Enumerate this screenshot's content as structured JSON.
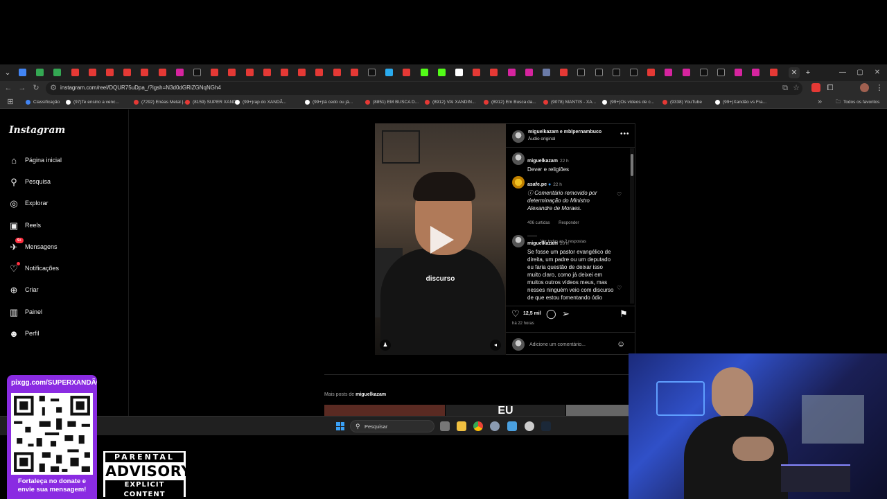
{
  "browser": {
    "url": "instagram.com/reel/DQUR75uDpa_/?igsh=N3d0dGRiZGNqNGh4",
    "bookmarks": [
      {
        "label": "Classificação",
        "color": "#4285f4"
      },
      {
        "label": "(97)Te ensino a venc...",
        "color": "#ffffff"
      },
      {
        "label": "(7292) Enéas Metal |...",
        "color": "#e53935"
      },
      {
        "label": "(8159) SUPER XAND...",
        "color": "#e53935"
      },
      {
        "label": "(99+)rap do XANDÃ...",
        "color": "#ffffff"
      },
      {
        "label": "(99+)tá cedo ou já...",
        "color": "#ffffff"
      },
      {
        "label": "(8851) EM BUSCA D...",
        "color": "#e53935"
      },
      {
        "label": "(8912) VAI XANDIN...",
        "color": "#e53935"
      },
      {
        "label": "(8912) Em Busca da...",
        "color": "#e53935"
      },
      {
        "label": "(9078) MANTIS - XA...",
        "color": "#e53935"
      },
      {
        "label": "(99+)Os vídeos de c...",
        "color": "#ffffff"
      },
      {
        "label": "(9338) YouTube",
        "color": "#e53935"
      },
      {
        "label": "(99+)Xandão vs Fra...",
        "color": "#ffffff"
      }
    ],
    "all_bookmarks": "Todos os favoritos"
  },
  "instagram": {
    "logo": "Instagram",
    "nav": [
      {
        "label": "Página inicial",
        "icon": "home-icon"
      },
      {
        "label": "Pesquisa",
        "icon": "search-icon"
      },
      {
        "label": "Explorar",
        "icon": "compass-icon"
      },
      {
        "label": "Reels",
        "icon": "reels-icon"
      },
      {
        "label": "Mensagens",
        "icon": "messenger-icon"
      },
      {
        "label": "Notificações",
        "icon": "heart-icon"
      },
      {
        "label": "Criar",
        "icon": "plus-icon"
      },
      {
        "label": "Painel",
        "icon": "dashboard-icon"
      },
      {
        "label": "Perfil",
        "icon": "profile-avatar"
      }
    ],
    "messages_badge": "9+",
    "reel_caption": "discurso",
    "post": {
      "header_users": "miguelkazam e mblpernambuco",
      "audio": "Áudio original",
      "comments": [
        {
          "user": "miguelkazam",
          "time": "22 h",
          "text": "Dever e religiões"
        },
        {
          "user": "asafe.pe",
          "time": "22 h",
          "text": "ⓘ Comentário removido por determinação do Ministro Alexandre de Moraes.",
          "likes": "406 curtidas",
          "reply": "Responder",
          "view_replies": "Ver todas as 2 respostas"
        },
        {
          "user": "miguelkazam",
          "time": "20 h",
          "text": "Se fosse um pastor evangélico de direita, um padre ou um deputado eu faria questão de deixar isso muito claro, como já deixei em muitos outros vídeos meus, mas nesses ninguém veio com discurso de que estou fomentando ódio"
        }
      ],
      "likes_count": "12,5 mil",
      "posted_ago": "há 22 horas",
      "comment_placeholder": "Adicione um comentário..."
    },
    "more_posts_prefix": "Mais posts de",
    "more_posts_user": "miguelkazam",
    "thumb_text": "EU"
  },
  "taskbar": {
    "search_placeholder": "Pesquisar"
  },
  "overlay": {
    "donate_url": "pixgg.com/SUPERXANDÃO",
    "donate_message_line1": "Fortaleça no donate e",
    "donate_message_line2": "envie sua mensagem!",
    "advisory_top": "PARENTAL",
    "advisory_mid": "ADVISORY",
    "advisory_bottom": "EXPLICIT CONTENT"
  }
}
